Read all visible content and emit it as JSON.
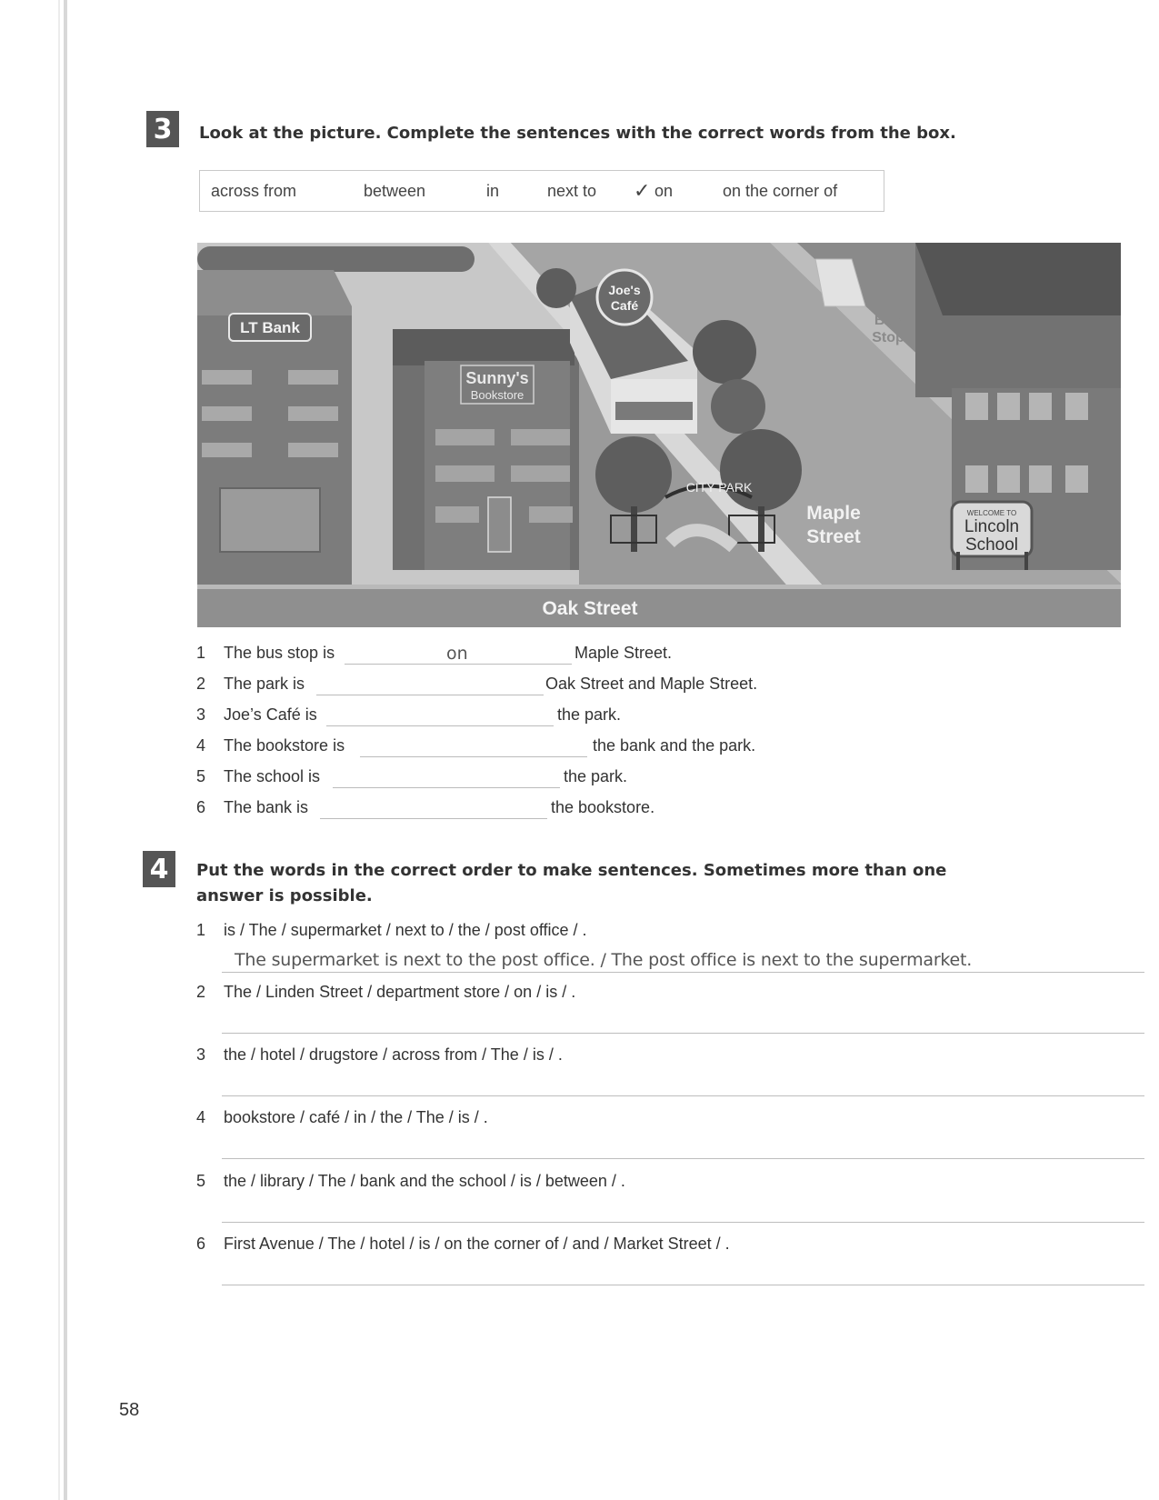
{
  "exercise3": {
    "number": "3",
    "instruction": "Look at the picture. Complete the sentences with the correct words from the box.",
    "word_box": {
      "words": [
        "across from",
        "between",
        "in",
        "next to",
        "on",
        "on the corner of"
      ],
      "checkmark": "✓"
    },
    "picture": {
      "bank_sign": "LT Bank",
      "bookstore_sign_line1": "Sunny's",
      "bookstore_sign_line2": "Bookstore",
      "cafe_sign_line1": "Joe's",
      "cafe_sign_line2": "Café",
      "park_sign": "CITY PARK",
      "bus_stop_line1": "Bus",
      "bus_stop_line2": "Stop",
      "maple_line1": "Maple",
      "maple_line2": "Street",
      "school_welcome": "WELCOME TO",
      "school_line1": "Lincoln",
      "school_line2": "School",
      "oak_street": "Oak Street"
    },
    "sentences": [
      {
        "num": "1",
        "start": "The bus stop is",
        "answer": "on",
        "end": "Maple Street."
      },
      {
        "num": "2",
        "start": "The park is",
        "answer": "",
        "end": "Oak Street and Maple Street."
      },
      {
        "num": "3",
        "start": "Joe’s Café is",
        "answer": "",
        "end": "the park."
      },
      {
        "num": "4",
        "start": "The bookstore is",
        "answer": "",
        "end": "the bank and the park."
      },
      {
        "num": "5",
        "start": "The school is",
        "answer": "",
        "end": "the park."
      },
      {
        "num": "6",
        "start": "The bank is",
        "answer": "",
        "end": "the bookstore."
      }
    ]
  },
  "exercise4": {
    "number": "4",
    "instruction_line1": "Put the words in the correct order to make sentences. Sometimes more than one",
    "instruction_line2": "answer is possible.",
    "items": [
      {
        "num": "1",
        "prompt": "is / The / supermarket / next to / the / post office / .",
        "answer": "The supermarket is next to the post office. / The post office is next to the supermarket."
      },
      {
        "num": "2",
        "prompt": "The / Linden Street / department store / on / is / ."
      },
      {
        "num": "3",
        "prompt": "the / hotel / drugstore / across from / The / is / ."
      },
      {
        "num": "4",
        "prompt": "bookstore / café / in / the / The / is / ."
      },
      {
        "num": "5",
        "prompt": "the / library / The / bank and the school / is / between / ."
      },
      {
        "num": "6",
        "prompt": "First Avenue / The / hotel / is / on the corner of / and / Market Street / ."
      }
    ]
  },
  "page_number": "58"
}
